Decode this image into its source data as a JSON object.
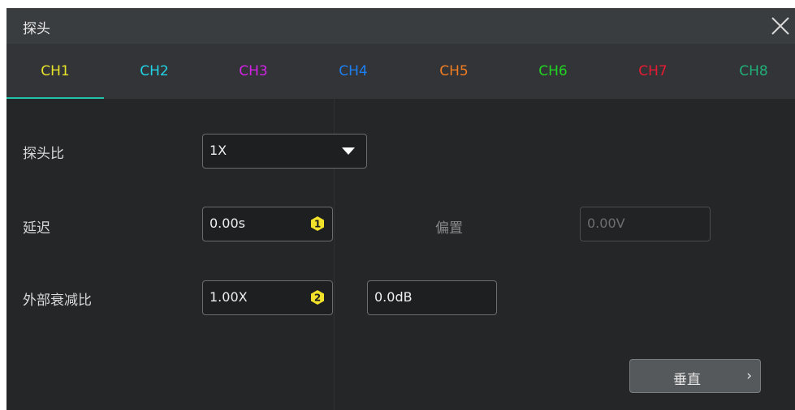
{
  "dialog": {
    "title": "探头",
    "close_icon": "close-icon"
  },
  "tabs": [
    {
      "label": "CH1",
      "color": "#e7e22a",
      "active": true
    },
    {
      "label": "CH2",
      "color": "#22d3e6",
      "active": false
    },
    {
      "label": "CH3",
      "color": "#d322e6",
      "active": false
    },
    {
      "label": "CH4",
      "color": "#1d7ef0",
      "active": false
    },
    {
      "label": "CH5",
      "color": "#f07c22",
      "active": false
    },
    {
      "label": "CH6",
      "color": "#22d322",
      "active": false
    },
    {
      "label": "CH7",
      "color": "#e61a33",
      "active": false
    },
    {
      "label": "CH8",
      "color": "#22b07a",
      "active": false
    }
  ],
  "form": {
    "probe_ratio": {
      "label": "探头比",
      "value": "1X"
    },
    "delay": {
      "label": "延迟",
      "value": "0.00s",
      "badge": "1"
    },
    "offset": {
      "label": "偏置",
      "value": "0.00V"
    },
    "ext_atten": {
      "label": "外部衰减比",
      "value": "1.00X",
      "badge": "2",
      "db_value": "0.0dB"
    }
  },
  "vertical_button": {
    "label": "垂直",
    "chevron": "›"
  },
  "accent_color": "#22c3ad",
  "badge_color": "#f2e12a"
}
